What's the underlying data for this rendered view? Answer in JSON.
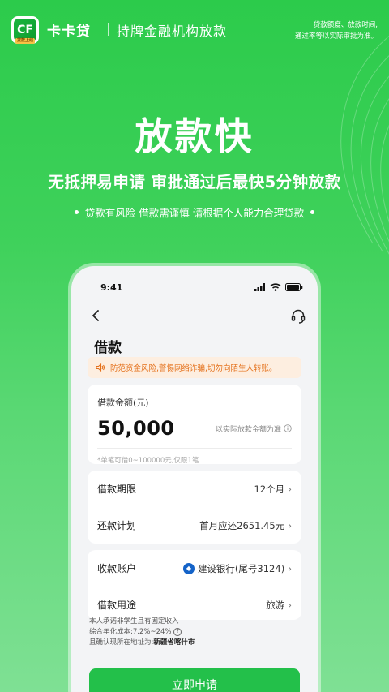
{
  "header": {
    "logo_text": "CF",
    "logo_tag": "贷款上线",
    "brand": "卡卡贷",
    "subtitle": "持牌金融机构放款",
    "disclaimer_line1": "贷款额度、放款时间,",
    "disclaimer_line2": "通过率等以实际审批为准。"
  },
  "hero": {
    "title": "放款快",
    "subtitle": "无抵押易申请 审批通过后最快5分钟放款",
    "risk_text": "贷款有风险 借款需谨慎 请根据个人能力合理贷款"
  },
  "phone": {
    "status_time": "9:41",
    "page_title": "借款",
    "notice_text": "防范资金风险,警惕网络诈骗,切勿向陌生人转账。",
    "amount": {
      "label": "借款金额(元)",
      "value": "50,000",
      "hint": "以实际放款金额为准",
      "limit_text": "*单笔可借0~100000元,仅限1笔"
    },
    "rows": [
      {
        "label": "借款期限",
        "value": "12个月"
      },
      {
        "label": "还款计划",
        "value": "首月应还2651.45元"
      }
    ],
    "rows2": [
      {
        "label": "收款账户",
        "value": "建设银行(尾号3124)"
      },
      {
        "label": "借款用途",
        "value": "旅游"
      }
    ],
    "promise_line1": "本人承诺非学生且有固定收入",
    "promise_line2": "综合年化成本:7.2%~24%",
    "promise_line3_prefix": "且确认现所在地址为:",
    "promise_line3_addr": "新疆省喀什市",
    "apply_label": "立即申请"
  },
  "colors": {
    "brand_green": "#23c04a",
    "notice_orange": "#e4701a",
    "bank_blue": "#1463c8"
  }
}
